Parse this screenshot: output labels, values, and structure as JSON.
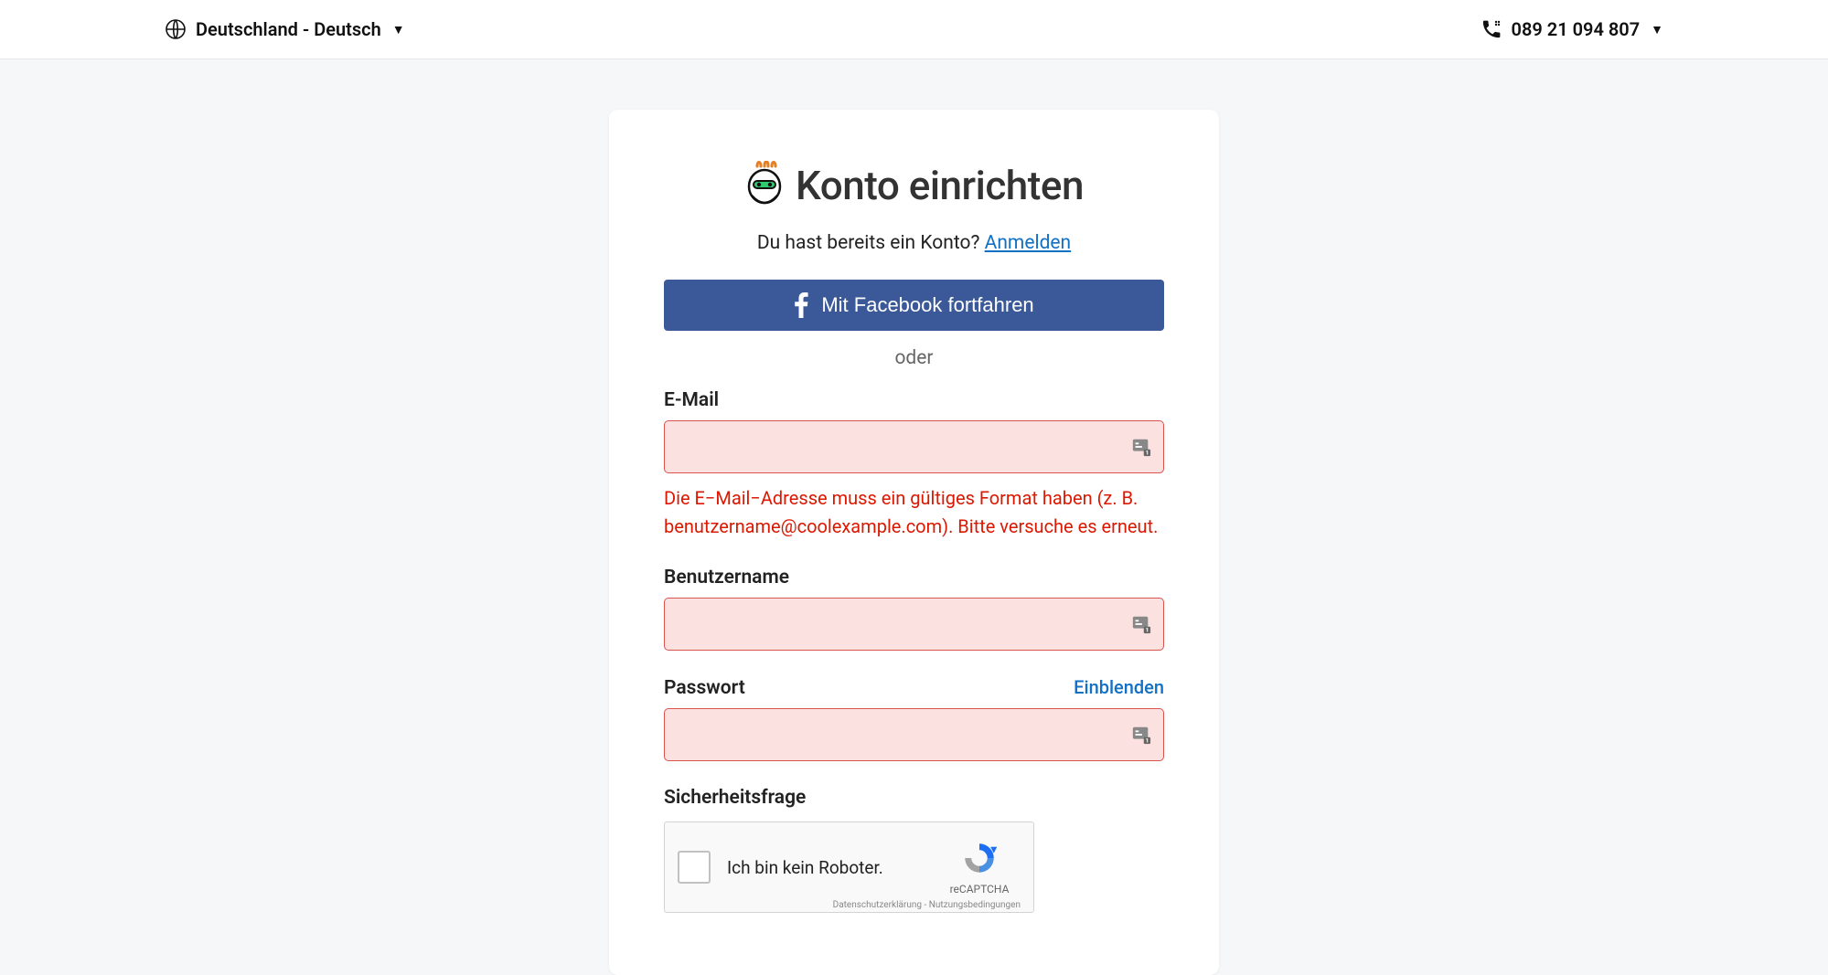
{
  "header": {
    "locale": "Deutschland - Deutsch",
    "phone": "089 21 094 807"
  },
  "card": {
    "title": "Konto einrichten",
    "already_have": "Du hast bereits ein Konto?",
    "signin": "Anmelden",
    "facebook_label": "Mit Facebook fortfahren",
    "divider": "oder",
    "email": {
      "label": "E-Mail",
      "error": "Die E−Mail−Adresse muss ein gültiges Format haben (z. B. benutzername@coolexample.com). Bitte versuche es erneut."
    },
    "username": {
      "label": "Benutzername"
    },
    "password": {
      "label": "Passwort",
      "show": "Einblenden"
    },
    "security_question": {
      "label": "Sicherheitsfrage"
    },
    "recaptcha": {
      "label": "Ich bin kein Roboter.",
      "brand": "reCAPTCHA",
      "terms": "Datenschutzerklärung - Nutzungsbedingungen"
    }
  }
}
